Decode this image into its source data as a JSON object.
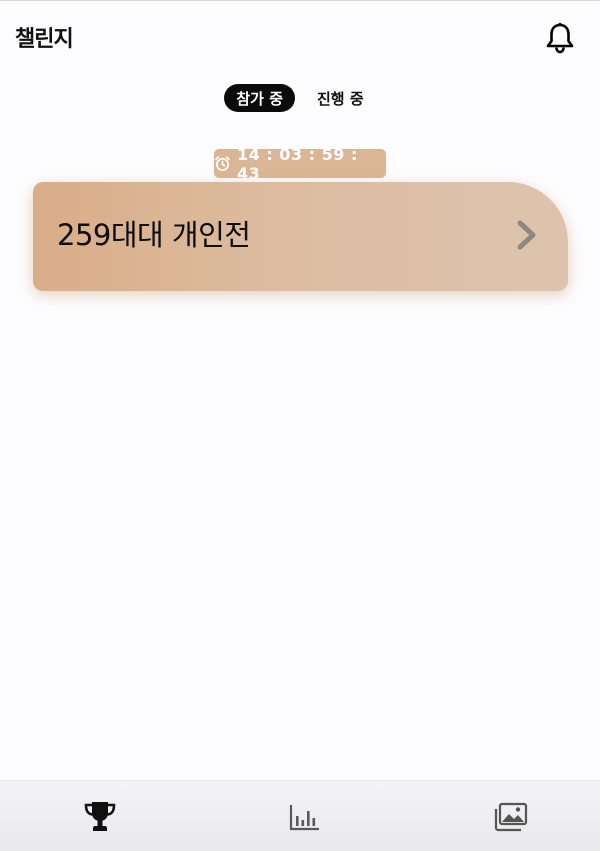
{
  "header": {
    "title": "챌린지",
    "notification_icon": "bell-icon"
  },
  "tabs": [
    {
      "label": "참가 중",
      "active": true
    },
    {
      "label": "진행 중",
      "active": false
    }
  ],
  "challenge": {
    "timer_icon": "alarm-clock-icon",
    "countdown": "14 : 03 : 59 : 43",
    "title": "259대대 개인전",
    "arrow_icon": "chevron-right-icon"
  },
  "bottom_nav": {
    "items": [
      {
        "icon": "trophy-icon",
        "active": true
      },
      {
        "icon": "bar-chart-icon",
        "active": false
      },
      {
        "icon": "photo-gallery-icon",
        "active": false
      }
    ]
  },
  "colors": {
    "accent": "#dbb696",
    "card_gradient_start": "#d9ad88",
    "card_gradient_end": "#ddc3ae",
    "active_tab": "#0b0b0b"
  }
}
